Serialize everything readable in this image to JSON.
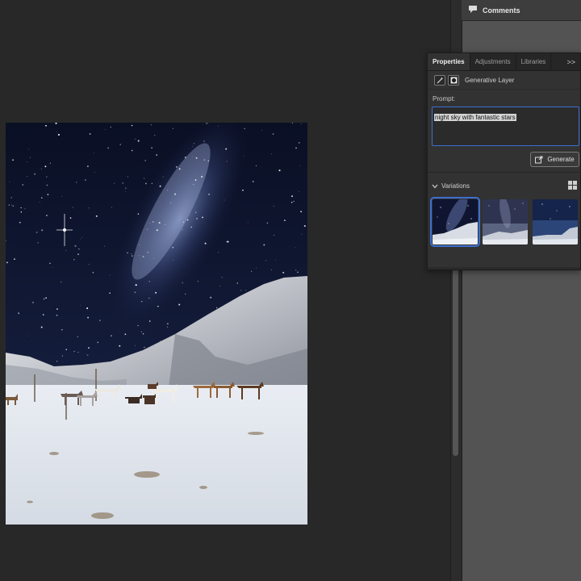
{
  "comments_panel": {
    "title": "Comments",
    "icon": "speech-bubble-icon"
  },
  "properties_panel": {
    "tabs": [
      {
        "label": "Properties",
        "active": true
      },
      {
        "label": "Adjustments",
        "active": false
      },
      {
        "label": "Libraries",
        "active": false
      }
    ],
    "more_label": ">>",
    "layer": {
      "name": "Generative Layer",
      "icons": [
        "generative-fill-icon",
        "mask-icon"
      ]
    },
    "prompt": {
      "label": "Prompt:",
      "value": "night sky with fantastic stars"
    },
    "generate_button": {
      "label": "Generate",
      "icon": "generate-icon"
    },
    "variations": {
      "label": "Variations",
      "view_icon": "grid-view-icon",
      "items": [
        {
          "name": "variation-1",
          "selected": true
        },
        {
          "name": "variation-2",
          "selected": false
        },
        {
          "name": "variation-3",
          "selected": false
        }
      ]
    }
  },
  "colors": {
    "accent": "#3d6fd1",
    "canvas_bg": "#282828",
    "panel_bg": "#323232",
    "dock_bg": "#535353"
  }
}
